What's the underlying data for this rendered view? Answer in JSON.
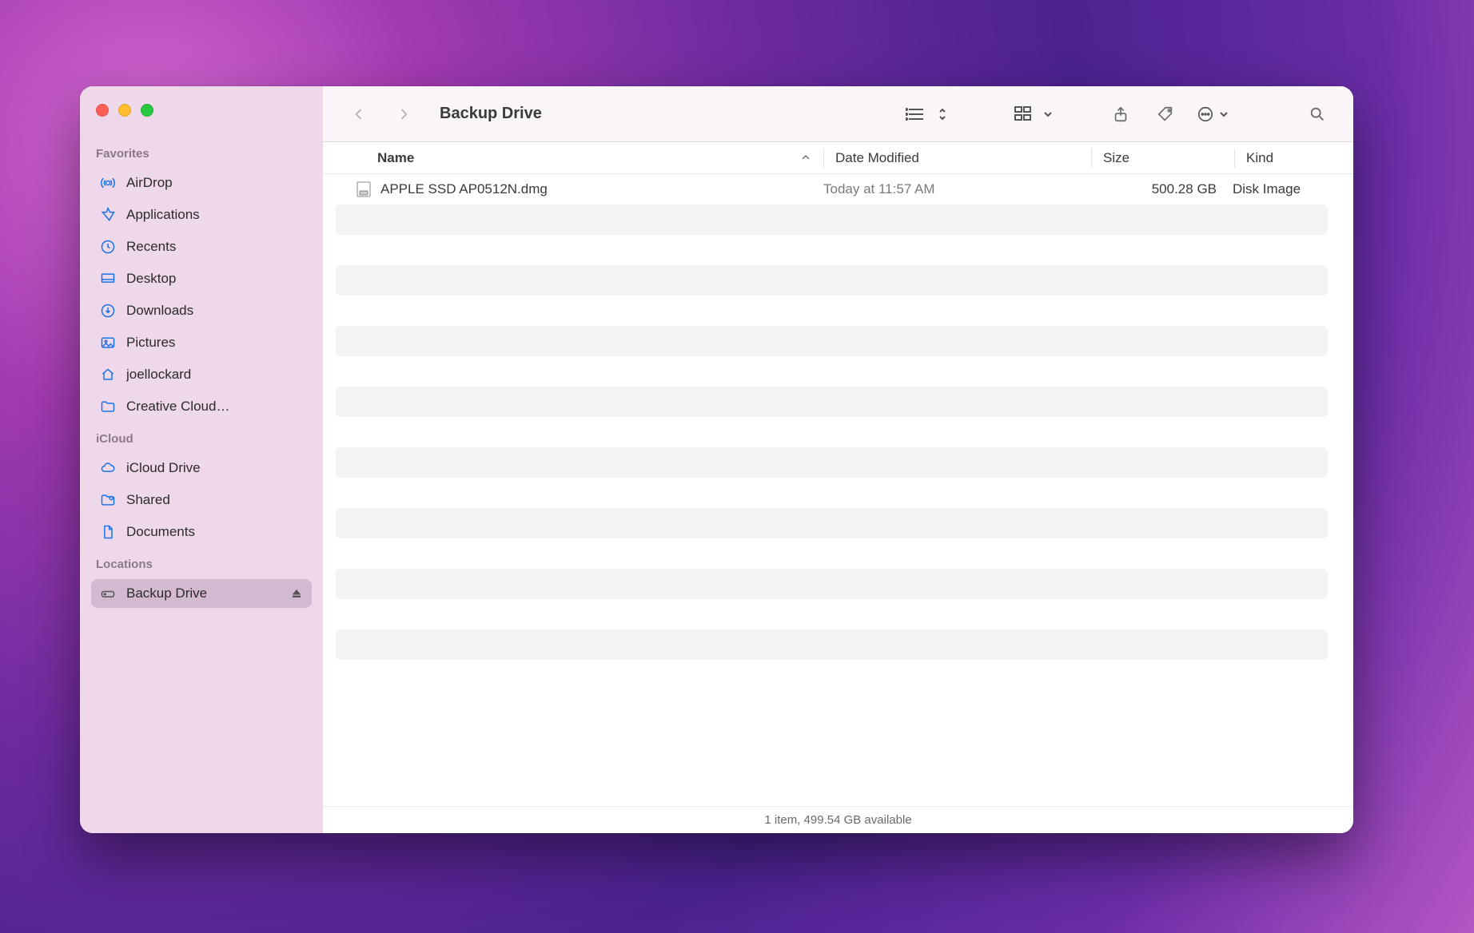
{
  "window": {
    "title": "Backup Drive"
  },
  "sidebar": {
    "sections": [
      {
        "header": "Favorites",
        "items": [
          {
            "name": "airdrop",
            "label": "AirDrop",
            "icon": "airdrop"
          },
          {
            "name": "applications",
            "label": "Applications",
            "icon": "apps"
          },
          {
            "name": "recents",
            "label": "Recents",
            "icon": "clock"
          },
          {
            "name": "desktop",
            "label": "Desktop",
            "icon": "desktop"
          },
          {
            "name": "downloads",
            "label": "Downloads",
            "icon": "download"
          },
          {
            "name": "pictures",
            "label": "Pictures",
            "icon": "image"
          },
          {
            "name": "home",
            "label": "joellockard",
            "icon": "home"
          },
          {
            "name": "creative-cloud",
            "label": "Creative Cloud…",
            "icon": "folder"
          }
        ]
      },
      {
        "header": "iCloud",
        "items": [
          {
            "name": "icloud-drive",
            "label": "iCloud Drive",
            "icon": "cloud"
          },
          {
            "name": "shared",
            "label": "Shared",
            "icon": "folder-shared"
          },
          {
            "name": "documents",
            "label": "Documents",
            "icon": "doc"
          }
        ]
      },
      {
        "header": "Locations",
        "items": [
          {
            "name": "backup-drive",
            "label": "Backup Drive",
            "icon": "drive",
            "selected": true,
            "ejectable": true
          }
        ]
      }
    ]
  },
  "columns": {
    "name": "Name",
    "date": "Date Modified",
    "size": "Size",
    "kind": "Kind"
  },
  "files": [
    {
      "name": "APPLE SSD AP0512N.dmg",
      "date": "Today at 11:57 AM",
      "size": "500.28 GB",
      "kind": "Disk Image"
    }
  ],
  "status": "1 item, 499.54 GB available"
}
